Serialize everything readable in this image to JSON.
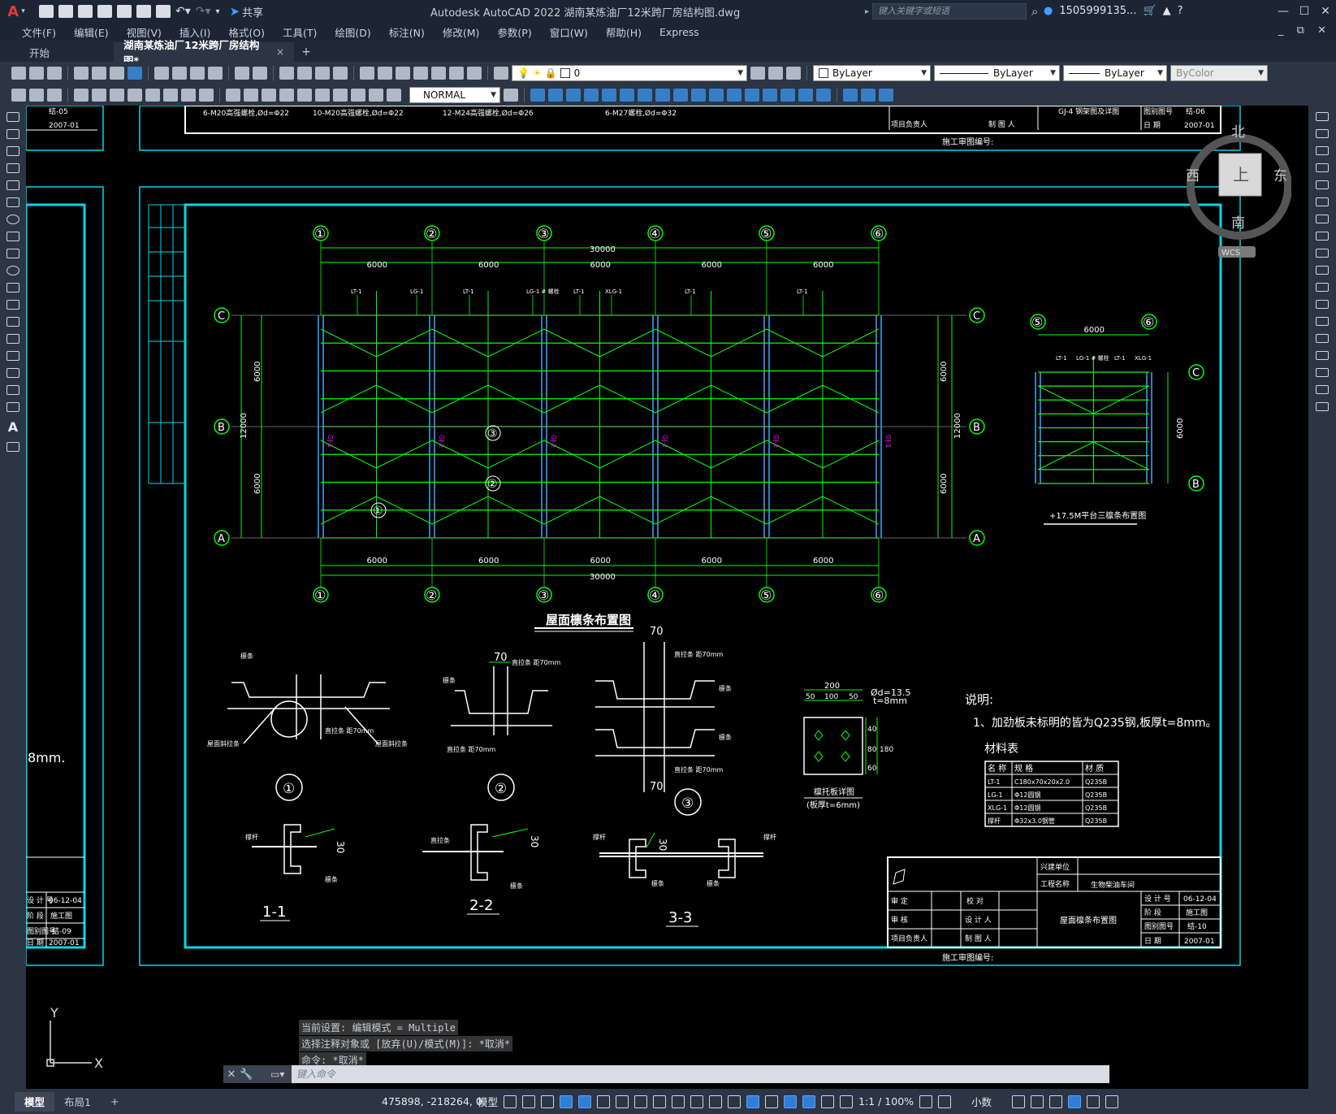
{
  "app": {
    "logo": "A",
    "title": "Autodesk AutoCAD 2022    湖南某炼油厂12米跨厂房结构图.dwg",
    "search_placeholder": "键入关键字或短语",
    "user": "1505999135...",
    "share": "共享"
  },
  "menu": [
    "文件(F)",
    "编辑(E)",
    "视图(V)",
    "插入(I)",
    "格式(O)",
    "工具(T)",
    "绘图(D)",
    "标注(N)",
    "修改(M)",
    "参数(P)",
    "窗口(W)",
    "帮助(H)",
    "Express"
  ],
  "tabs": {
    "start": "开始",
    "active": "湖南某炼油厂12米跨厂房结构图*",
    "close": "×",
    "plus": "+"
  },
  "properties": {
    "layer": "0",
    "color": "ByLayer",
    "linetype": "ByLayer",
    "lineweight": "ByLayer",
    "plotstyle": "ByColor",
    "dimstyle": "NORMAL"
  },
  "viewcube": {
    "north": "北",
    "south": "南",
    "east": "东",
    "west": "西",
    "face": "上",
    "wcs": "WCS"
  },
  "drawing": {
    "top_notes": [
      "6-M20高强螺栓,Ød=Φ22",
      "10-M20高强螺栓,Ød=Φ22",
      "12-M24高强螺栓,Ød=Φ26",
      "6-M27螺栓,Ød=Φ32"
    ],
    "prev_sheet": {
      "title": "GJ-4 钢架图及详图",
      "num_label": "图别图号",
      "num": "结-06",
      "date_label": "日    期",
      "date": "2007-01",
      "pm": "项目负责人",
      "draw": "制 图 人",
      "review": "施工审图编号:"
    },
    "left_sheet": {
      "num1": "结-05",
      "date1": "2007-01",
      "design": "设 计 号",
      "design_val": "06-12-04",
      "stage": "阶    段",
      "stage_val": "施工图",
      "num_label": "图别图号",
      "num_val": "结-09",
      "date_label": "日    期",
      "date_val": "2007-01",
      "note": "8mm."
    },
    "axes_cols": [
      "①",
      "②",
      "③",
      "④",
      "⑤",
      "⑥"
    ],
    "axes_rows": [
      "C",
      "B",
      "A"
    ],
    "spans": [
      "6000",
      "6000",
      "6000",
      "6000",
      "6000"
    ],
    "total": "30000",
    "height_dims": [
      "6000",
      "6000",
      "12000"
    ],
    "purlin_labels": [
      "LT-1",
      "LG-1",
      "LT-1",
      "LG-1 # 螺栓",
      "LT-1",
      "XLG-1",
      "LT-1",
      "LT-1"
    ],
    "gj_labels": [
      "GJ-1",
      "GJ-2",
      "GJ-2",
      "GJ-2",
      "GJ-2",
      "GJ-1"
    ],
    "main_title": "屋面檩条布置图",
    "side_plan": {
      "axes": [
        "⑤",
        "⑥"
      ],
      "rows": [
        "C",
        "B"
      ],
      "span": "6000",
      "height": "6000",
      "labels": [
        "LT-1",
        "LG-1 # 螺栓",
        "LT-1",
        "XLG-1"
      ],
      "title": "+17.5M平台三檩条布置图"
    },
    "details": {
      "d1": "①",
      "d2": "②",
      "d3": "③",
      "s1": "1-1",
      "s2": "2-2",
      "s3": "3-3",
      "dim70": "70",
      "dim30": "30",
      "lbl_purlin": "檩条",
      "lbl_tie": "直拉条",
      "lbl_brace": "撑杆",
      "lbl_bolt": "螺栓",
      "lbl_d70": "直拉条 距70mm",
      "lbl_roof": "屋面斜拉条",
      "plate_title": "檩托板详图",
      "plate_note": "(板厚t=6mm)",
      "plate_dims": [
        "200",
        "50",
        "100",
        "50",
        "40",
        "80",
        "60",
        "180"
      ],
      "plate_hole": "Ød=13.5",
      "plate_t": "t=8mm"
    },
    "notes": {
      "heading": "说明:",
      "line1": "1、加劲板未标明的皆为Q235钢,板厚t=8mm。",
      "table_title": "材料表",
      "headers": [
        "名 称",
        "规    格",
        "材 质"
      ],
      "rows": [
        [
          "LT-1",
          "C180x70x20x2.0",
          "Q235B"
        ],
        [
          "LG-1",
          "Φ12圆钢",
          "Q235B"
        ],
        [
          "XLG-1",
          "Φ12圆钢",
          "Q235B"
        ],
        [
          "撑杆",
          "Φ32x3.0钢管",
          "Q235B"
        ]
      ]
    },
    "title_block": {
      "owner_label": "兴建单位",
      "project_label": "工程名称",
      "project": "生物柴油车间",
      "approve": "审    定",
      "check": "审    核",
      "pm": "项目负责人",
      "proof": "校    对",
      "designer": "设 计 人",
      "drafter": "制 图 人",
      "drawing_title": "屋面檩条布置图",
      "design_no_label": "设 计 号",
      "design_no": "06-12-04",
      "stage_label": "阶    段",
      "stage": "施工图",
      "sheet_label": "图别图号",
      "sheet": "结-10",
      "date_label": "日    期",
      "date": "2007-01",
      "review": "施工审图编号:"
    },
    "ucs": {
      "y": "Y",
      "x": "X"
    }
  },
  "command": {
    "history": [
      "当前设置: 编辑模式 = Multiple",
      "选择注释对象或 [放弃(U)/模式(M)]: *取消*",
      "命令: *取消*"
    ],
    "placeholder": "键入命令"
  },
  "status": {
    "model_tab": "模型",
    "layout_tab": "布局1",
    "plus": "+",
    "coords": "475898, -218264, 0",
    "space": "模型",
    "scale": "1:1 / 100%",
    "units": "小数"
  },
  "colors": {
    "cad_green": "#00ff00",
    "cad_cyan": "#00d8e8",
    "cad_white": "#ffffff",
    "cad_magenta": "#ff00ff",
    "cad_blue_col": "#3da7ff",
    "ui_dark": "#1b2533",
    "ui_panel": "#2b3544"
  }
}
